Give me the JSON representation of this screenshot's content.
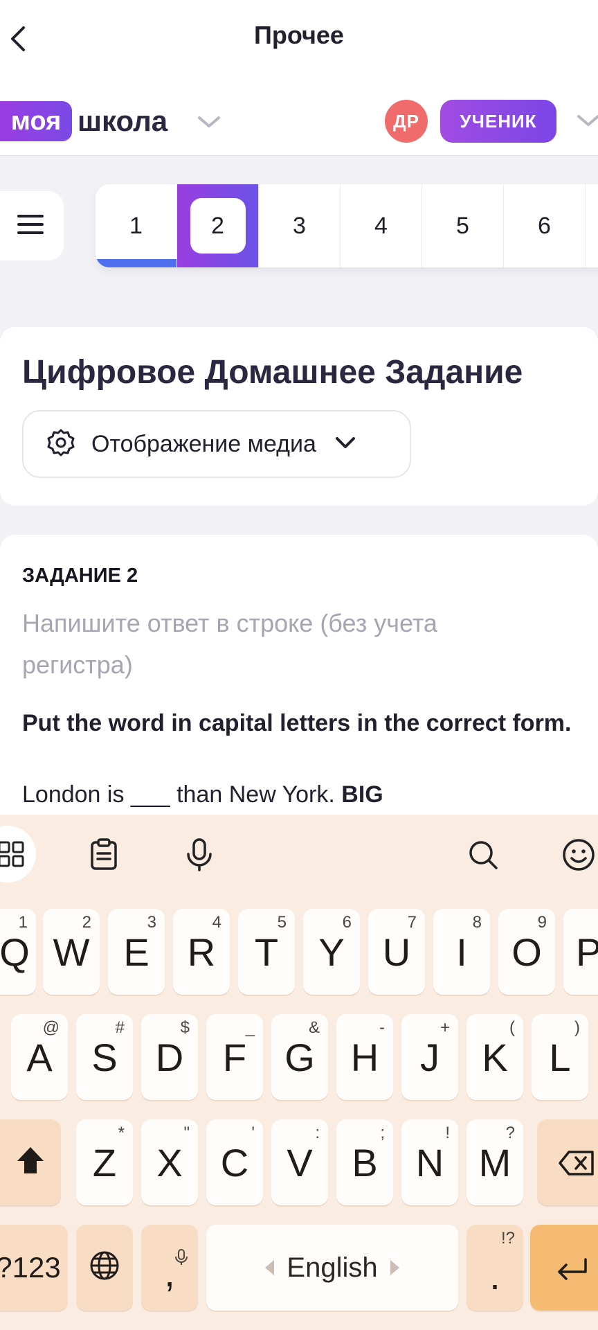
{
  "header": {
    "title": "Прочее",
    "logo_pill": "моя",
    "logo_text": "школа",
    "avatar_initials": "ДР",
    "role_badge": "УЧЕНИК"
  },
  "task_nav": {
    "tabs": [
      "1",
      "2",
      "3",
      "4",
      "5",
      "6"
    ],
    "active_tab": "2",
    "completed_tab": "1",
    "accent_color": "#8a45e4",
    "completed_color": "#4f6fee"
  },
  "homework": {
    "heading": "Цифровое Домашнее Задание",
    "media_button": "Отображение медиа"
  },
  "task": {
    "label": "ЗАДАНИЕ 2",
    "hint": "Напишите ответ в строке (без учета регистра)",
    "prompt": "Put the word in capital letters in the correct form.",
    "sentence_start": "London is",
    "blank": "___",
    "sentence_end": "than New York.",
    "keyword": "BIG"
  },
  "keyboard": {
    "row1": [
      {
        "key": "Q",
        "sup": "1"
      },
      {
        "key": "W",
        "sup": "2"
      },
      {
        "key": "E",
        "sup": "3"
      },
      {
        "key": "R",
        "sup": "4"
      },
      {
        "key": "T",
        "sup": "5"
      },
      {
        "key": "Y",
        "sup": "6"
      },
      {
        "key": "U",
        "sup": "7"
      },
      {
        "key": "I",
        "sup": "8"
      },
      {
        "key": "O",
        "sup": "9"
      },
      {
        "key": "P",
        "sup": ""
      }
    ],
    "row2": [
      {
        "key": "A",
        "sup": "@"
      },
      {
        "key": "S",
        "sup": "#"
      },
      {
        "key": "D",
        "sup": "$"
      },
      {
        "key": "F",
        "sup": "_"
      },
      {
        "key": "G",
        "sup": "&"
      },
      {
        "key": "H",
        "sup": "-"
      },
      {
        "key": "J",
        "sup": "+"
      },
      {
        "key": "K",
        "sup": "("
      },
      {
        "key": "L",
        "sup": ")"
      }
    ],
    "row3": [
      {
        "key": "Z",
        "sup": "*"
      },
      {
        "key": "X",
        "sup": "\""
      },
      {
        "key": "C",
        "sup": "'"
      },
      {
        "key": "V",
        "sup": ":"
      },
      {
        "key": "B",
        "sup": ";"
      },
      {
        "key": "N",
        "sup": "!"
      },
      {
        "key": "M",
        "sup": "?"
      }
    ],
    "symbols_key": "?123",
    "comma_key": ",",
    "space_label": "English",
    "period_key": ".",
    "period_sup": "!?"
  },
  "icons": [
    "back-icon",
    "chevron-down-icon",
    "hamburger-menu-icon",
    "gear-icon",
    "apps-grid-icon",
    "clipboard-icon",
    "microphone-icon",
    "search-icon",
    "emoji-icon",
    "shift-icon",
    "backspace-icon",
    "globe-icon",
    "enter-icon"
  ]
}
